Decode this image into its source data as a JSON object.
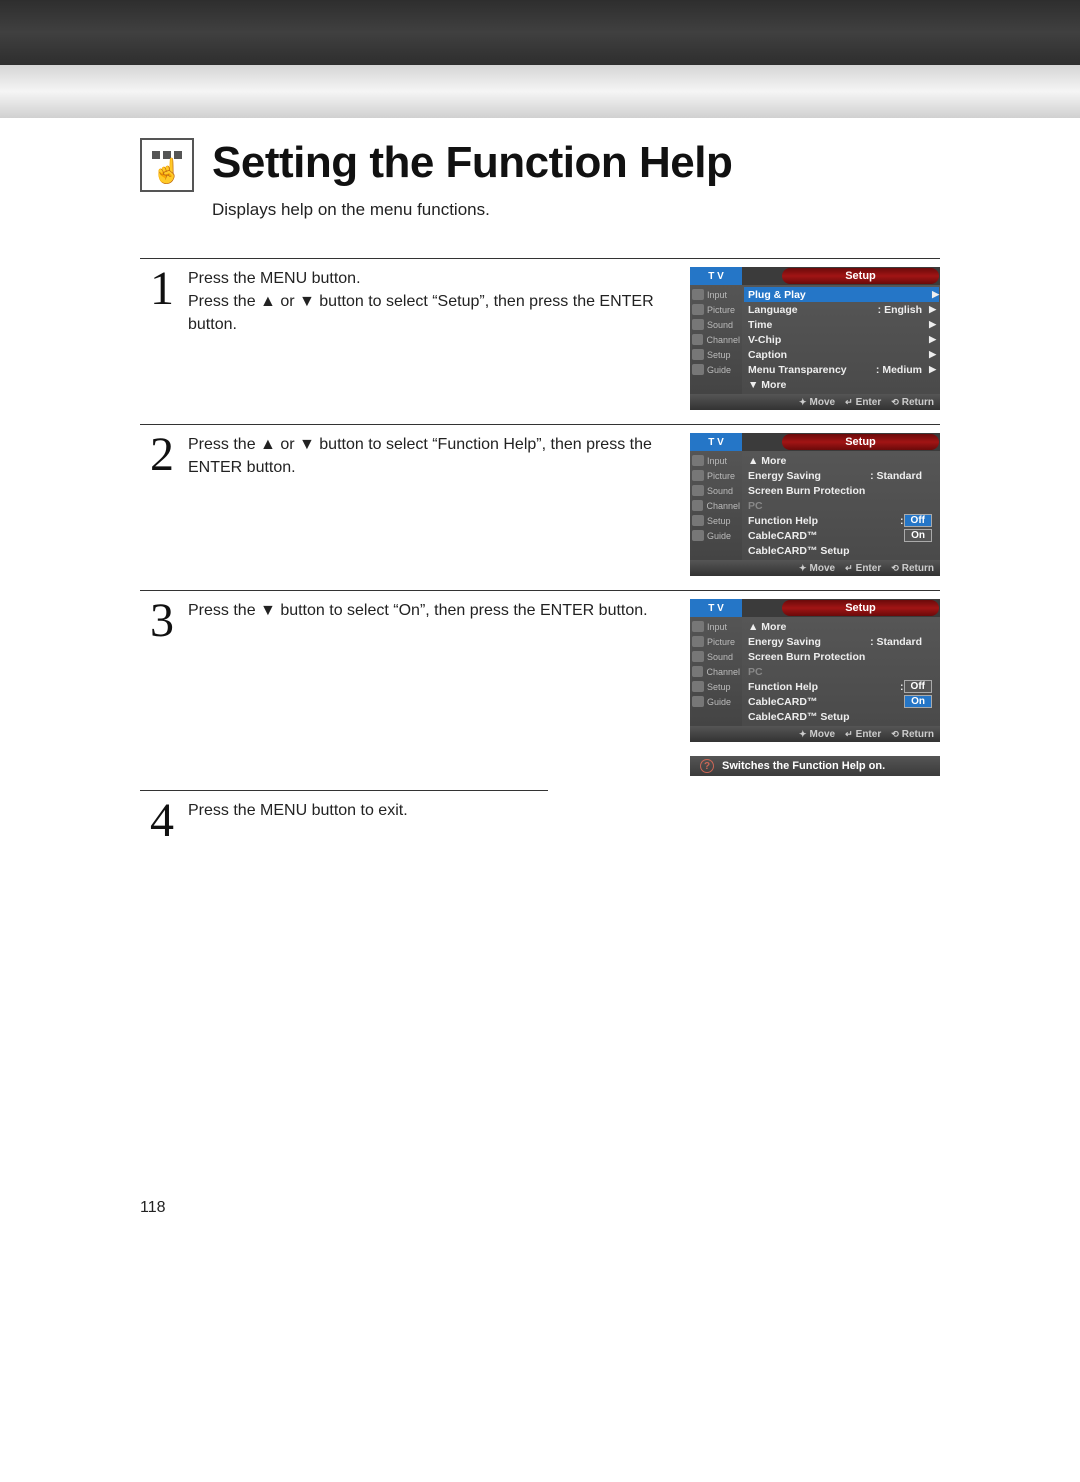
{
  "title": "Setting the Function Help",
  "subtitle": "Displays help on the menu functions.",
  "steps": {
    "s1": {
      "num": "1",
      "text": "Press the MENU button.\nPress the ▲ or ▼ button to select “Setup”, then press the ENTER button."
    },
    "s2": {
      "num": "2",
      "text": "Press the ▲ or ▼ button to select “Function Help”, then press the ENTER button."
    },
    "s3": {
      "num": "3",
      "text": "Press the ▼ button to select “On”, then press the ENTER button."
    },
    "s4": {
      "num": "4",
      "text": "Press the MENU button to exit."
    }
  },
  "osd": {
    "tv": "T V",
    "setup": "Setup",
    "sidebar": [
      "Input",
      "Picture",
      "Sound",
      "Channel",
      "Setup",
      "Guide"
    ],
    "footer": {
      "move": "Move",
      "enter": "Enter",
      "return": "Return"
    }
  },
  "osd1": {
    "rows": [
      {
        "label": "Plug & Play",
        "val": "",
        "sel": true,
        "arrow": true
      },
      {
        "label": "Language",
        "val": ": English",
        "arrow": true
      },
      {
        "label": "Time",
        "val": "",
        "arrow": true
      },
      {
        "label": "V-Chip",
        "val": "",
        "arrow": true
      },
      {
        "label": "Caption",
        "val": "",
        "arrow": true
      },
      {
        "label": "Menu Transparency",
        "val": ": Medium",
        "arrow": true
      },
      {
        "label": "▼ More",
        "val": ""
      }
    ]
  },
  "osd2": {
    "rows": [
      {
        "label": "▲ More",
        "val": ""
      },
      {
        "label": "Energy Saving",
        "val": ": Standard"
      },
      {
        "label": "Screen Burn Protection",
        "val": ""
      },
      {
        "label": "PC",
        "val": "",
        "grey": true
      },
      {
        "label": "Function Help",
        "val": ": ",
        "box": "Off",
        "boxsel": true
      },
      {
        "label": "CableCARD™",
        "val": "",
        "box": "On"
      },
      {
        "label": "CableCARD™ Setup",
        "val": ""
      }
    ]
  },
  "osd3": {
    "rows": [
      {
        "label": "▲ More",
        "val": ""
      },
      {
        "label": "Energy Saving",
        "val": ": Standard"
      },
      {
        "label": "Screen Burn Protection",
        "val": ""
      },
      {
        "label": "PC",
        "val": "",
        "grey": true
      },
      {
        "label": "Function Help",
        "val": ": ",
        "box": "Off"
      },
      {
        "label": "CableCARD™",
        "val": "",
        "box": "On",
        "boxsel": true
      },
      {
        "label": "CableCARD™ Setup",
        "val": ""
      }
    ]
  },
  "help_bar": "Switches the Function Help on.",
  "page_number": "118"
}
